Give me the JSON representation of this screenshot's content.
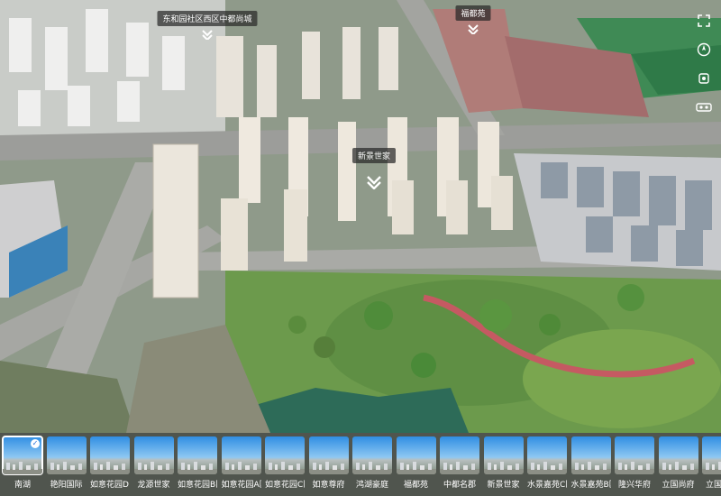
{
  "map_labels": [
    {
      "name": "donghe-label",
      "text": "东和园社区西区中都尚城"
    },
    {
      "name": "fuyuan-label",
      "text": "福都苑"
    },
    {
      "name": "center-label",
      "text": "新景世家"
    }
  ],
  "side_icons": [
    "expand-icon",
    "compass-icon",
    "gyroscope-icon",
    "vr-glasses-icon"
  ],
  "thumbnails": [
    {
      "label": "南湖",
      "selected": true
    },
    {
      "label": "艳阳国际",
      "selected": false
    },
    {
      "label": "如意花园D E",
      "selected": false
    },
    {
      "label": "龙源世家",
      "selected": false
    },
    {
      "label": "如意花园B区",
      "selected": false
    },
    {
      "label": "如意花园A区",
      "selected": false
    },
    {
      "label": "如意花园C区",
      "selected": false
    },
    {
      "label": "如意尊府",
      "selected": false
    },
    {
      "label": "鸿湖豪庭",
      "selected": false
    },
    {
      "label": "福都苑",
      "selected": false
    },
    {
      "label": "中都名郡",
      "selected": false
    },
    {
      "label": "新景世家",
      "selected": false
    },
    {
      "label": "水景嘉苑C区",
      "selected": false
    },
    {
      "label": "水景嘉苑B区",
      "selected": false
    },
    {
      "label": "隆兴华府",
      "selected": false
    },
    {
      "label": "立国尚府",
      "selected": false
    },
    {
      "label": "立国尚府",
      "selected": false
    }
  ]
}
